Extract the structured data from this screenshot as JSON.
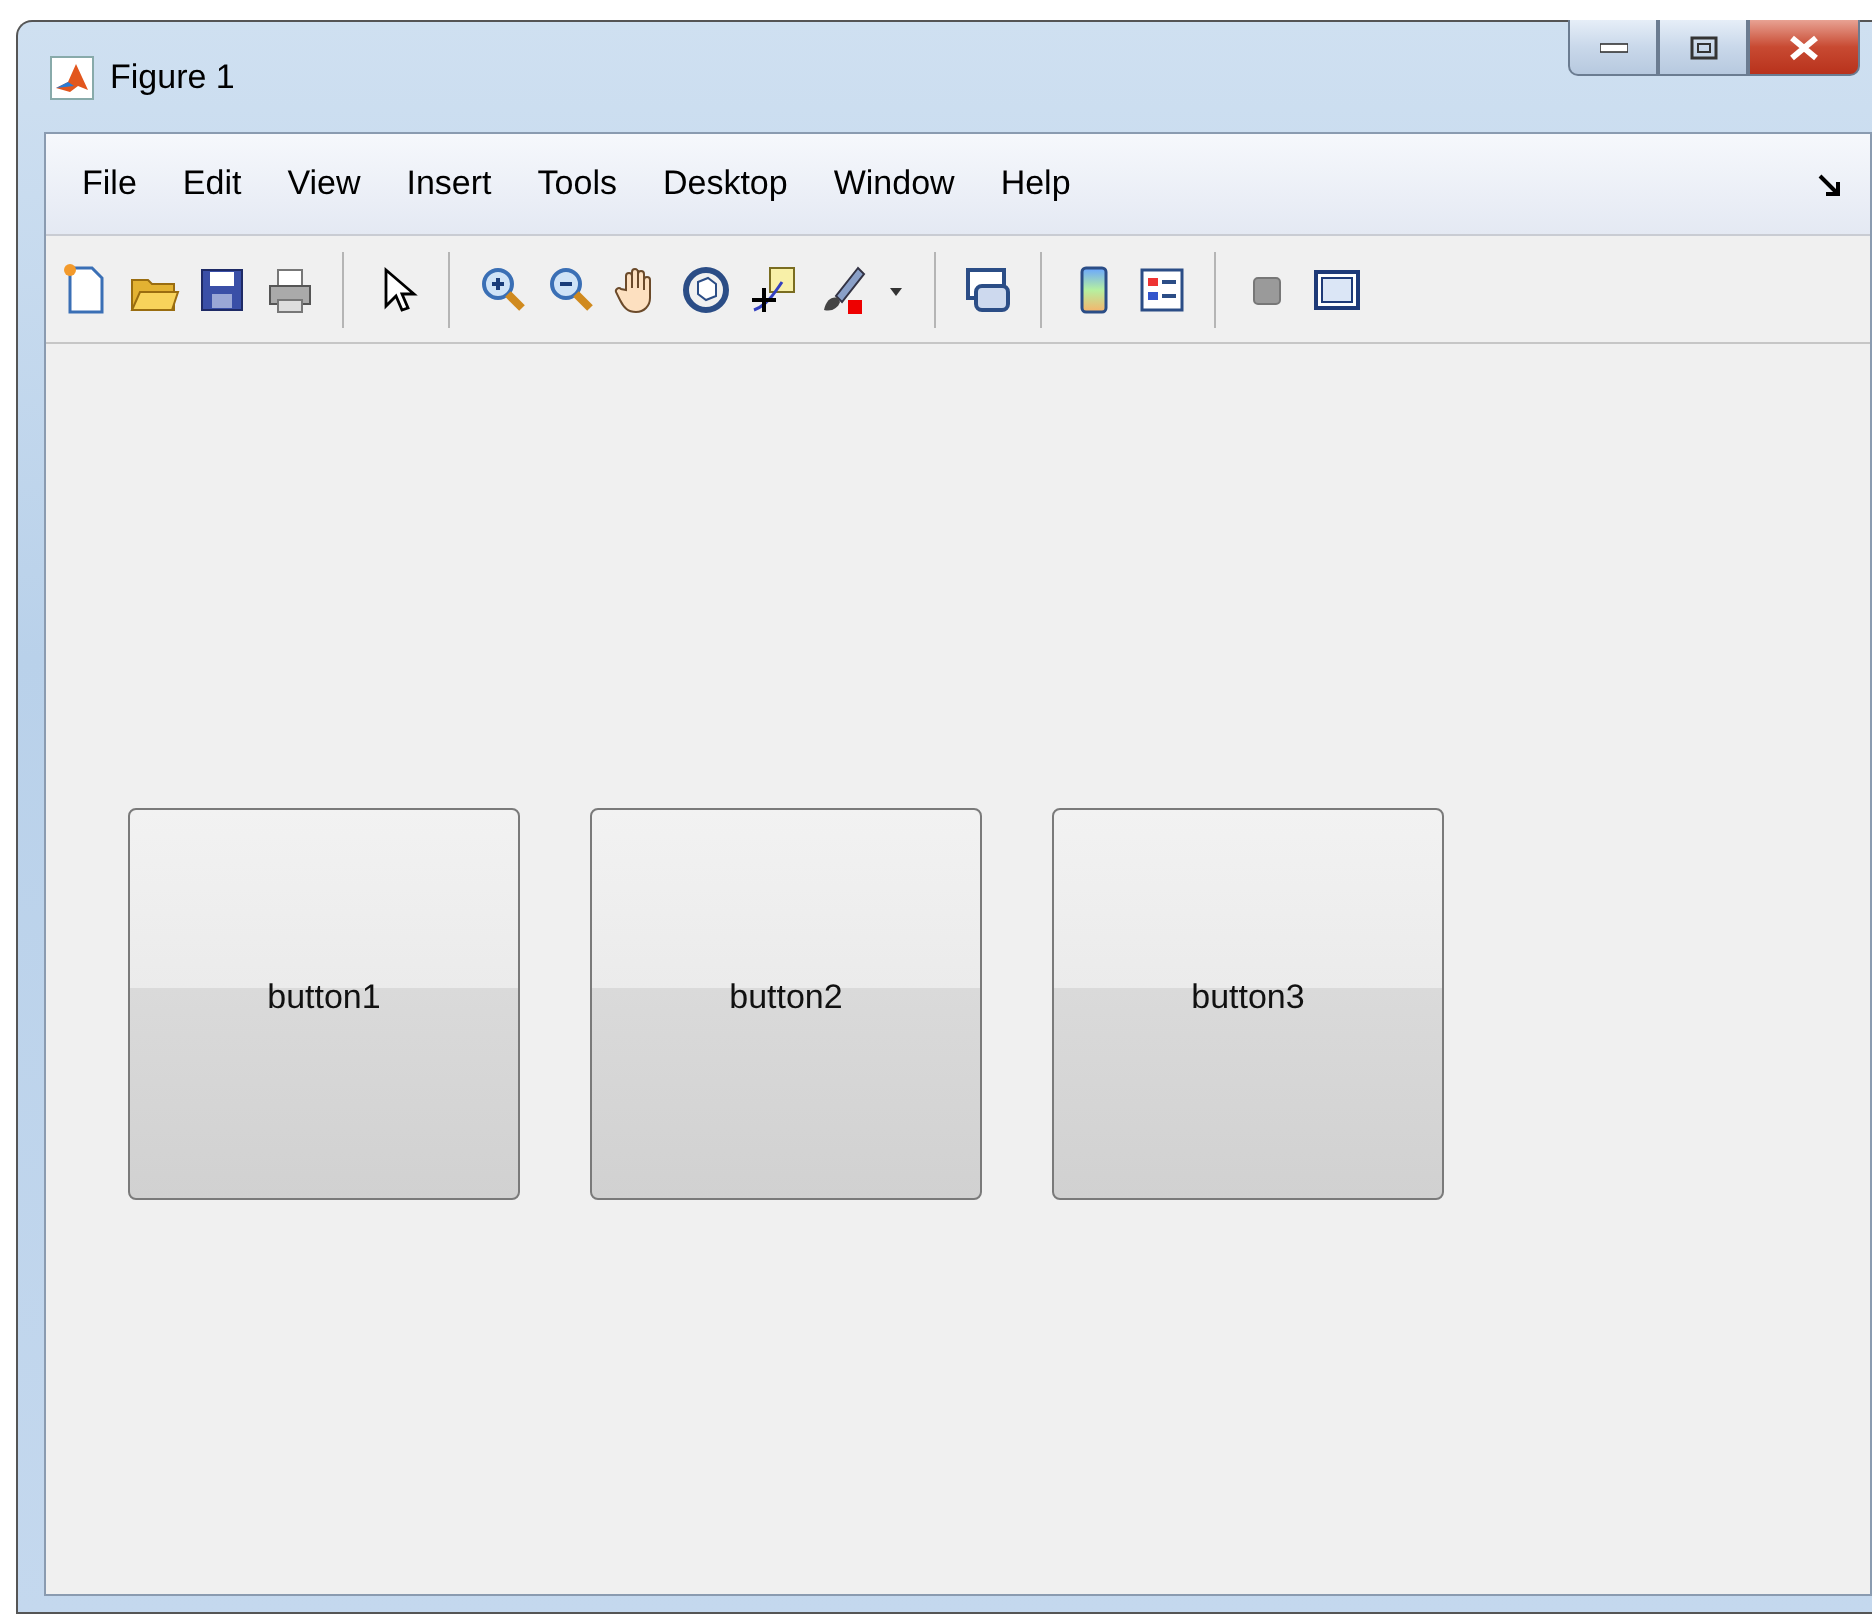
{
  "window": {
    "title": "Figure 1"
  },
  "menu": [
    "File",
    "Edit",
    "View",
    "Insert",
    "Tools",
    "Desktop",
    "Window",
    "Help"
  ],
  "buttons": [
    "button1",
    "button2",
    "button3"
  ]
}
